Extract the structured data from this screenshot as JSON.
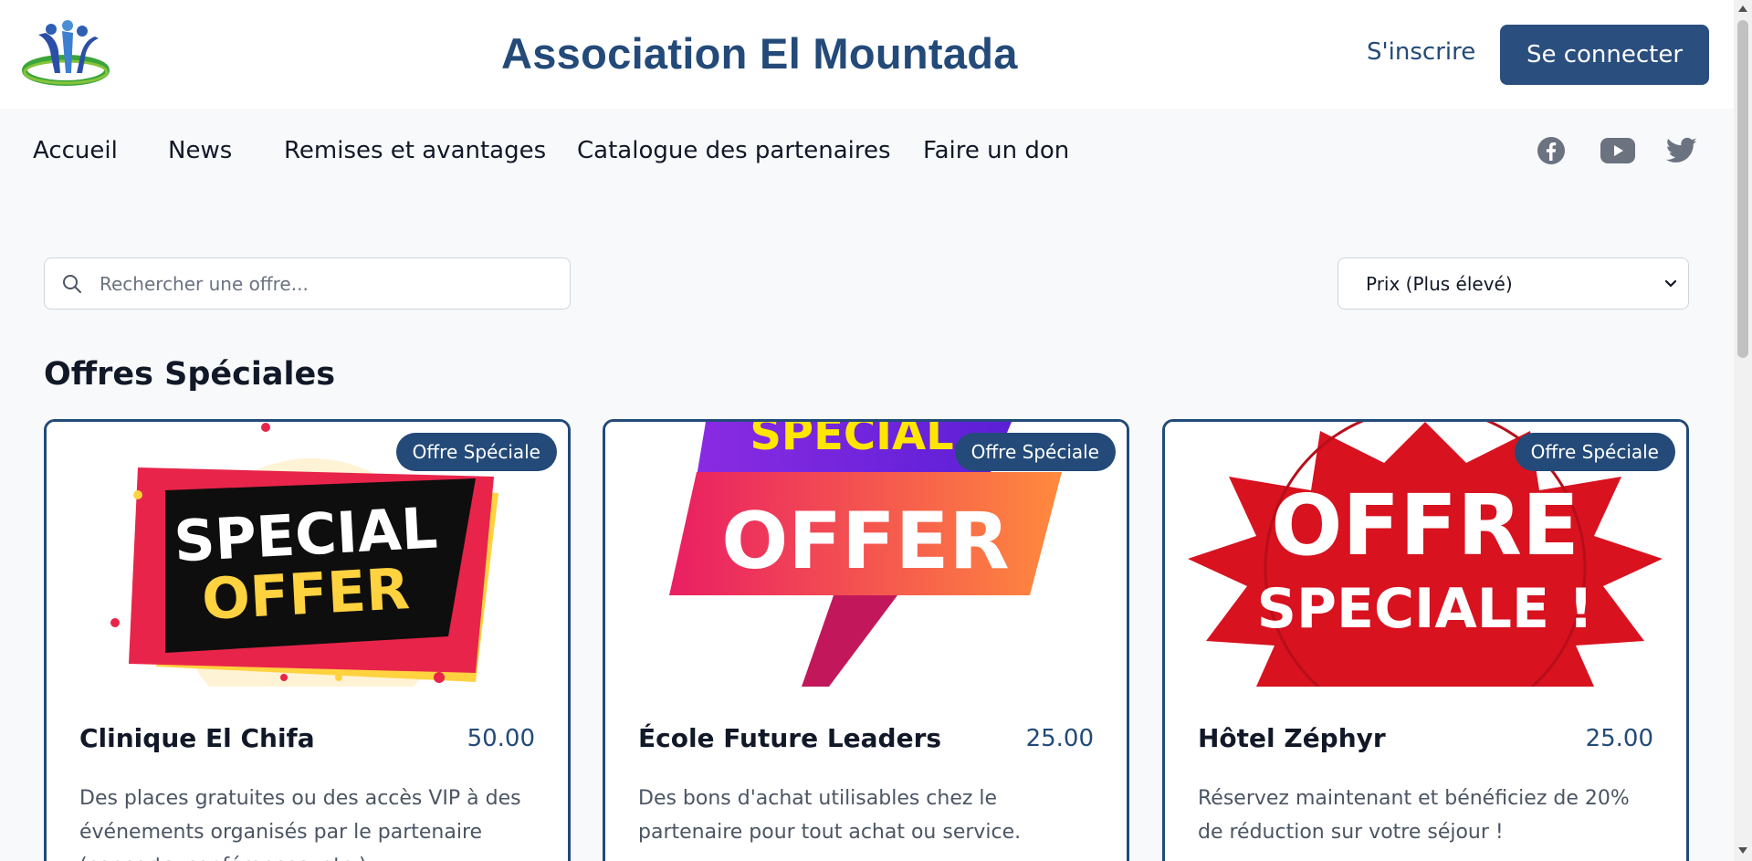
{
  "header": {
    "title": "Association El Mountada",
    "signup_label": "S'inscrire",
    "login_label": "Se connecter"
  },
  "nav": {
    "items": [
      {
        "label": "Accueil"
      },
      {
        "label": "News"
      },
      {
        "label": "Remises et avantages"
      },
      {
        "label": "Catalogue des partenaires"
      },
      {
        "label": "Faire un don"
      }
    ],
    "social": [
      "facebook-icon",
      "youtube-icon",
      "twitter-icon"
    ]
  },
  "search": {
    "placeholder": "Rechercher une offre...",
    "value": ""
  },
  "sort": {
    "selected": "Prix (Plus élevé)"
  },
  "section": {
    "title": "Offres Spéciales"
  },
  "cards": [
    {
      "badge": "Offre Spéciale",
      "name": "Clinique El Chifa",
      "price": "50.00",
      "description": "Des places gratuites ou des accès VIP à des événements organisés par le partenaire (concerts, conférences, etc.).",
      "image_text": [
        "SPECIAL",
        "OFFER"
      ]
    },
    {
      "badge": "Offre Spéciale",
      "name": "École Future Leaders",
      "price": "25.00",
      "description": "Des bons d'achat utilisables chez le partenaire pour tout achat ou service.",
      "image_text": [
        "SPECIAL",
        "OFFER"
      ]
    },
    {
      "badge": "Offre Spéciale",
      "name": "Hôtel Zéphyr",
      "price": "25.00",
      "description": "Réservez maintenant et bénéficiez de 20% de réduction sur votre séjour !",
      "image_text": [
        "OFFRE",
        "SPECIALE !"
      ]
    }
  ],
  "colors": {
    "brand": "#234a78",
    "background": "#f8f9fb"
  }
}
